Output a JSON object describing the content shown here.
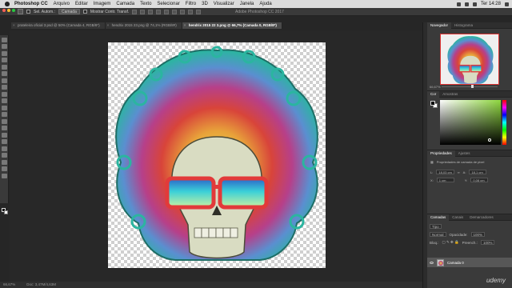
{
  "menubar": {
    "app_name": "Photoshop CC",
    "items": [
      "Arquivo",
      "Editar",
      "Imagem",
      "Camada",
      "Texto",
      "Selecionar",
      "Filtro",
      "3D",
      "Visualizar",
      "Janela",
      "Ajuda"
    ],
    "clock": "Ter 14:28"
  },
  "window": {
    "title": "Adobe Photoshop CC 2017"
  },
  "options_bar": {
    "autoselect_label": "Sel. Autom.:",
    "autoselect_value": "Camada",
    "transform_label": "Mostrar Contr. Transf."
  },
  "tabs": [
    {
      "label": "prateleira oficial 3.psd @ 50% (Camada 4, RGB/8*)",
      "active": false
    },
    {
      "label": "hendrix 2015 23.png @ 74,1% (RGB/8#)",
      "active": false
    },
    {
      "label": "hendrix 2015 22 3.png @ 66,7% (Camada 0, RGB/8*)",
      "active": true
    }
  ],
  "status": {
    "zoom": "66,67%",
    "doc": "Doc: 3,47M/4,63M"
  },
  "navigator": {
    "tabs": [
      "Navegador",
      "Histograma"
    ],
    "zoom": "66,67%"
  },
  "color": {
    "tabs": [
      "Cor",
      "Amostras"
    ],
    "picker_hue": "#8fd83f"
  },
  "properties": {
    "tabs": [
      "Propriedades",
      "Ajustes"
    ],
    "subtitle": "Propriedades de camada de pixel",
    "w": "18,03 cm",
    "h": "18,1 cm",
    "x": "1 cm",
    "y": "0,08 cm"
  },
  "layers": {
    "tabs": [
      "Camadas",
      "Canais",
      "Demarcadores"
    ],
    "kind_label": "Tipo",
    "blend_mode": "Normal",
    "opacity_label": "Opacidade:",
    "opacity": "100%",
    "lock_label": "Bloq.:",
    "fill_label": "Preench.:",
    "fill": "100%",
    "layer_name": "Camada 0"
  },
  "watermark": "udemy"
}
